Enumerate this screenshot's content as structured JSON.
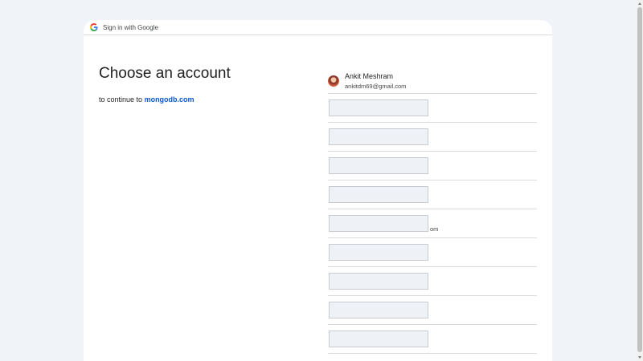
{
  "header": {
    "title": "Sign in with Google",
    "logo_icon": "google-g-icon"
  },
  "main": {
    "title": "Choose an account",
    "continue_prefix": "to continue to",
    "continue_domain": "mongodb.com"
  },
  "accounts": [
    {
      "name": "Ankit Meshram",
      "email": "ankitdm69@gmail.com",
      "avatar_icon": "user-avatar"
    }
  ],
  "redacted_rows": [
    {
      "suffix": ""
    },
    {
      "suffix": ""
    },
    {
      "suffix": ""
    },
    {
      "suffix": ""
    },
    {
      "suffix": "om"
    },
    {
      "suffix": ""
    },
    {
      "suffix": ""
    },
    {
      "suffix": ""
    },
    {
      "suffix": ""
    }
  ],
  "colors": {
    "background": "#f0f4f9",
    "link_blue": "#0b57d0",
    "divider": "#dadce0"
  }
}
